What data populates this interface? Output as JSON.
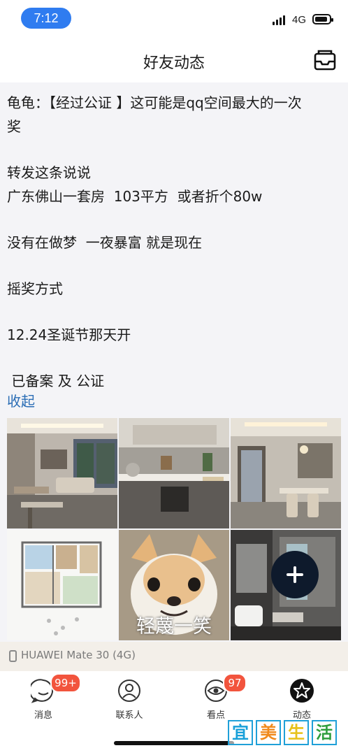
{
  "status_bar": {
    "time": "7:12",
    "network": "4G"
  },
  "header": {
    "title": "好友动态"
  },
  "post": {
    "lines": [
      "龟龟：【经过公证 】这可能是qq空间最大的一次",
      "奖",
      "",
      "转发这条说说",
      "广东佛山一套房  103平方  或者折个80w",
      "",
      "没有在做梦  一夜暴富 就是现在",
      "",
      "摇奖方式",
      "",
      "12.24圣诞节那天开",
      "",
      " 已备案 及 公证"
    ],
    "collapse_label": "收起",
    "meme_caption": "轻蔑一笑",
    "device": "HUAWEI Mate 30 (4G)"
  },
  "tabs": [
    {
      "label": "消息",
      "badge": "99+",
      "icon": "message-icon"
    },
    {
      "label": "联系人",
      "icon": "contacts-icon"
    },
    {
      "label": "看点",
      "badge": "97",
      "icon": "eye-icon"
    },
    {
      "label": "动态",
      "icon": "star-icon",
      "active": true
    }
  ],
  "watermark": [
    "宜",
    "美",
    "生",
    "活"
  ]
}
